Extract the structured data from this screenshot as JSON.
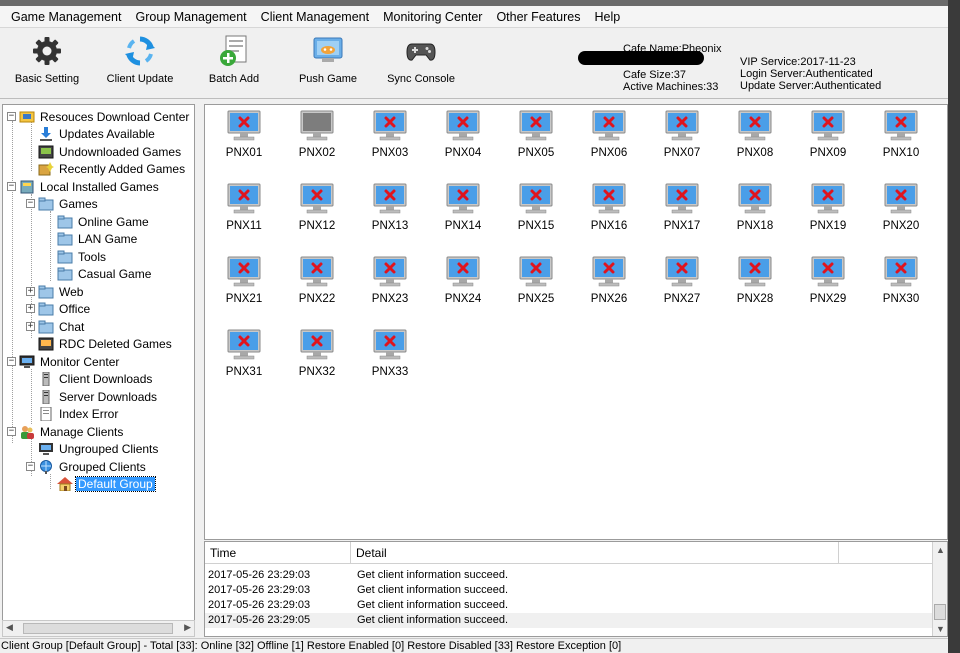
{
  "menu": [
    "Game Management",
    "Group Management",
    "Client Management",
    "Monitoring Center",
    "Other Features",
    "Help"
  ],
  "toolbar": {
    "basic_setting": "Basic Setting",
    "client_update": "Client Update",
    "batch_add": "Batch Add",
    "push_game": "Push Game",
    "sync_console": "Sync Console"
  },
  "cafe": {
    "name": "Cafe Name:Pheonix",
    "size": "Cafe Size:37",
    "active": "Active Machines:33",
    "vip": "VIP Service:2017-11-23",
    "login": "Login Server:Authenticated",
    "update": "Update Server:Authenticated"
  },
  "tree": [
    {
      "label": "Resouces Download Center",
      "icon": "folder-computer-icon"
    },
    {
      "label": "Updates Available",
      "icon": "download-icon"
    },
    {
      "label": "Undownloaded Games",
      "icon": "game-box-icon"
    },
    {
      "label": "Recently Added Games",
      "icon": "new-games-icon"
    },
    {
      "label": "Local Installed Games",
      "icon": "local-disk-icon"
    },
    {
      "label": "Games",
      "icon": "folder-icon"
    },
    {
      "label": "Online Game",
      "icon": "folder-icon"
    },
    {
      "label": "LAN Game",
      "icon": "folder-icon"
    },
    {
      "label": "Tools",
      "icon": "folder-icon"
    },
    {
      "label": "Casual Game",
      "icon": "folder-icon"
    },
    {
      "label": "Web",
      "icon": "folder-icon"
    },
    {
      "label": "Office",
      "icon": "folder-icon"
    },
    {
      "label": "Chat",
      "icon": "folder-icon"
    },
    {
      "label": "RDC Deleted Games",
      "icon": "deleted-games-icon"
    },
    {
      "label": "Monitor Center",
      "icon": "monitor-icon"
    },
    {
      "label": "Client Downloads",
      "icon": "server-icon"
    },
    {
      "label": "Server Downloads",
      "icon": "server-icon"
    },
    {
      "label": "Index Error",
      "icon": "document-icon"
    },
    {
      "label": "Manage Clients",
      "icon": "users-icon"
    },
    {
      "label": "Ungrouped Clients",
      "icon": "computer-icon"
    },
    {
      "label": "Grouped Clients",
      "icon": "globe-icon"
    },
    {
      "label": "Default Group",
      "icon": "house-icon"
    }
  ],
  "clients": [
    {
      "name": "PNX01",
      "status": "offline-error"
    },
    {
      "name": "PNX02",
      "status": "online"
    },
    {
      "name": "PNX03",
      "status": "offline-error"
    },
    {
      "name": "PNX04",
      "status": "offline-error"
    },
    {
      "name": "PNX05",
      "status": "offline-error"
    },
    {
      "name": "PNX06",
      "status": "offline-error"
    },
    {
      "name": "PNX07",
      "status": "offline-error"
    },
    {
      "name": "PNX08",
      "status": "offline-error"
    },
    {
      "name": "PNX09",
      "status": "offline-error"
    },
    {
      "name": "PNX10",
      "status": "offline-error"
    },
    {
      "name": "PNX11",
      "status": "offline-error"
    },
    {
      "name": "PNX12",
      "status": "offline-error"
    },
    {
      "name": "PNX13",
      "status": "offline-error"
    },
    {
      "name": "PNX14",
      "status": "offline-error"
    },
    {
      "name": "PNX15",
      "status": "offline-error"
    },
    {
      "name": "PNX16",
      "status": "offline-error"
    },
    {
      "name": "PNX17",
      "status": "offline-error"
    },
    {
      "name": "PNX18",
      "status": "offline-error"
    },
    {
      "name": "PNX19",
      "status": "offline-error"
    },
    {
      "name": "PNX20",
      "status": "offline-error"
    },
    {
      "name": "PNX21",
      "status": "offline-error"
    },
    {
      "name": "PNX22",
      "status": "offline-error"
    },
    {
      "name": "PNX23",
      "status": "offline-error"
    },
    {
      "name": "PNX24",
      "status": "offline-error"
    },
    {
      "name": "PNX25",
      "status": "offline-error"
    },
    {
      "name": "PNX26",
      "status": "offline-error"
    },
    {
      "name": "PNX27",
      "status": "offline-error"
    },
    {
      "name": "PNX28",
      "status": "offline-error"
    },
    {
      "name": "PNX29",
      "status": "offline-error"
    },
    {
      "name": "PNX30",
      "status": "offline-error"
    },
    {
      "name": "PNX31",
      "status": "offline-error"
    },
    {
      "name": "PNX32",
      "status": "offline-error"
    },
    {
      "name": "PNX33",
      "status": "offline-error"
    }
  ],
  "log": {
    "columns": [
      "Time",
      "Detail"
    ],
    "rows": [
      {
        "time": "2017-05-26 23:29:03",
        "detail": "Get client information succeed."
      },
      {
        "time": "2017-05-26 23:29:03",
        "detail": "Get client information succeed."
      },
      {
        "time": "2017-05-26 23:29:03",
        "detail": "Get client information succeed."
      },
      {
        "time": "2017-05-26 23:29:05",
        "detail": "Get client information succeed."
      }
    ]
  },
  "status_bar": "Client Group [Default Group] - Total [33]: Online [32] Offline [1] Restore Enabled [0] Restore Disabled [33] Restore Exception [0]",
  "colors": {
    "selection": "#3399ff",
    "monitor_blue": "#4a9ee8",
    "error_red": "#e0141e"
  }
}
